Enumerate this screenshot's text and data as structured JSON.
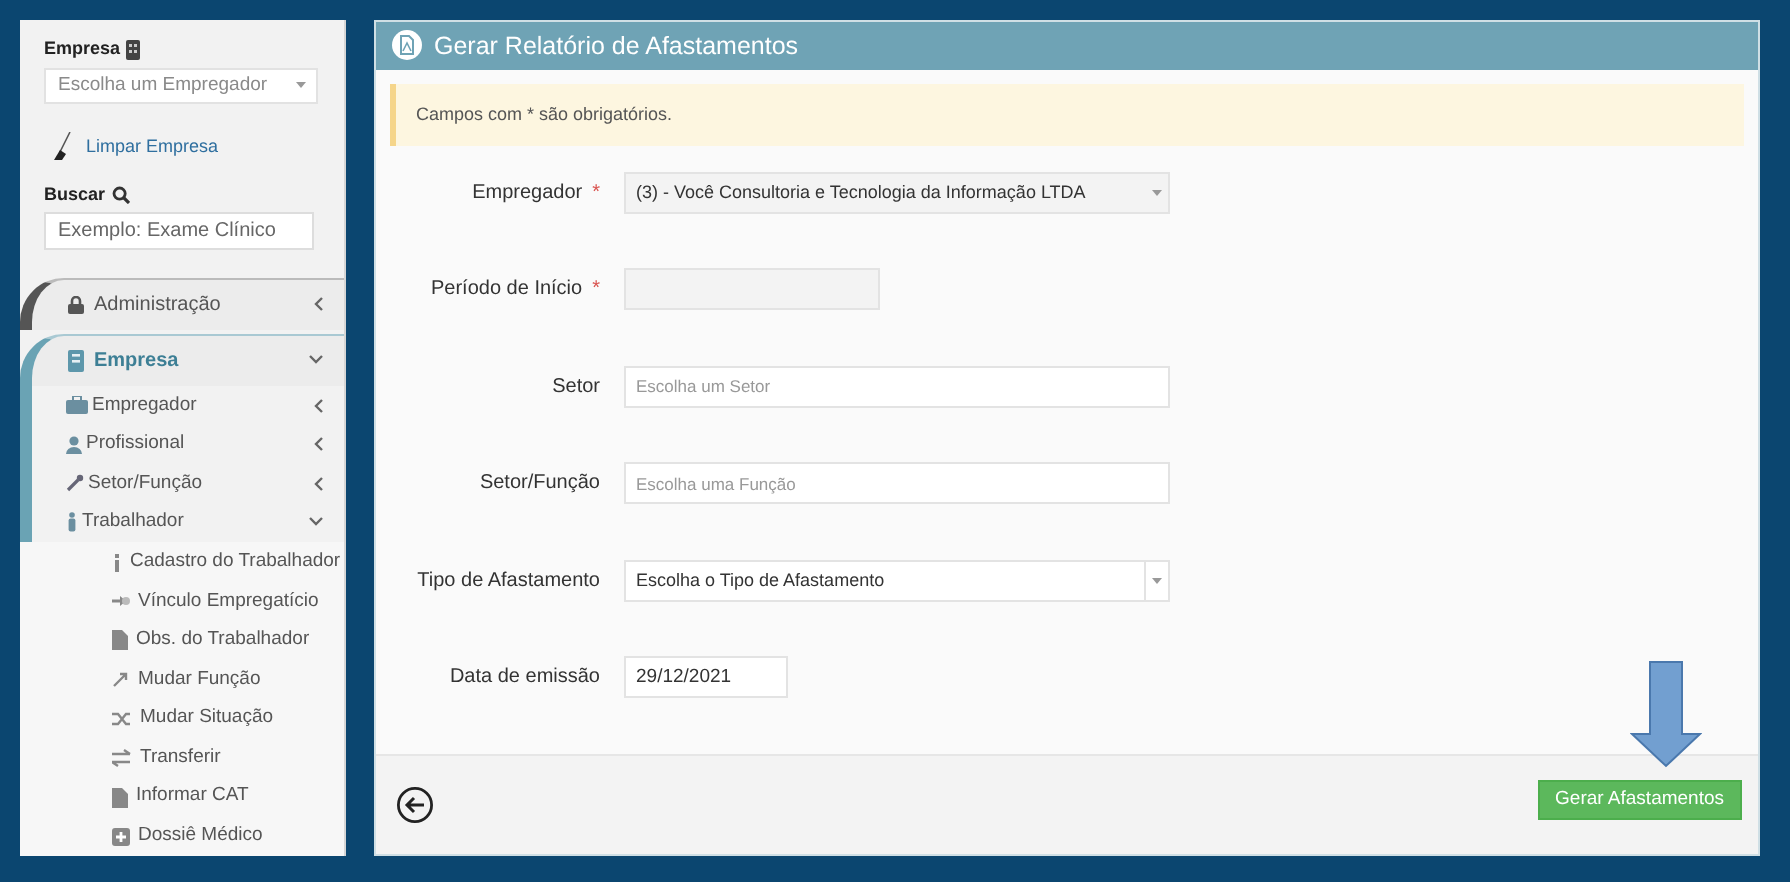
{
  "sidebar": {
    "company_label": "Empresa",
    "company_select": {
      "placeholder": "Escolha um Empregador"
    },
    "clear_link": "Limpar Empresa",
    "search_label": "Buscar",
    "search": {
      "placeholder": "Exemplo: Exame Clínico"
    },
    "menu": [
      {
        "label": "Administração",
        "expanded": false
      },
      {
        "label": "Empresa",
        "expanded": true,
        "children": [
          {
            "label": "Empregador",
            "expanded": false
          },
          {
            "label": "Profissional",
            "expanded": false
          },
          {
            "label": "Setor/Função",
            "expanded": false
          },
          {
            "label": "Trabalhador",
            "expanded": true,
            "children": [
              {
                "label": "Cadastro do Trabalhador"
              },
              {
                "label": "Vínculo Empregatício"
              },
              {
                "label": "Obs. do Trabalhador"
              },
              {
                "label": "Mudar Função"
              },
              {
                "label": "Mudar Situação"
              },
              {
                "label": "Transferir"
              },
              {
                "label": "Informar CAT"
              },
              {
                "label": "Dossiê Médico"
              }
            ]
          }
        ]
      }
    ]
  },
  "panel": {
    "title": "Gerar Relatório de Afastamentos",
    "notice": "Campos com * são obrigatórios.",
    "fields": [
      {
        "label": "Empregador",
        "required_mark": "*",
        "kind": "select",
        "value": "(3) - Você Consultoria e Tecnologia da Informação LTDA",
        "disabled": true
      },
      {
        "label": "Período de Início",
        "required_mark": "*",
        "kind": "short",
        "disabled": true
      },
      {
        "label": "Setor",
        "kind": "input",
        "placeholder": "Escolha um Setor",
        "disabled": false
      },
      {
        "label": "Setor/Função",
        "kind": "input",
        "placeholder": "Escolha uma Função",
        "disabled": false
      },
      {
        "label": "Tipo de Afastamento",
        "kind": "select",
        "value": "Escolha o Tipo de Afastamento",
        "disabled": false
      },
      {
        "label": "Data de emissão",
        "kind": "date",
        "value": "29/12/2021",
        "disabled": false
      }
    ],
    "submit_button": "Gerar Afastamentos"
  }
}
